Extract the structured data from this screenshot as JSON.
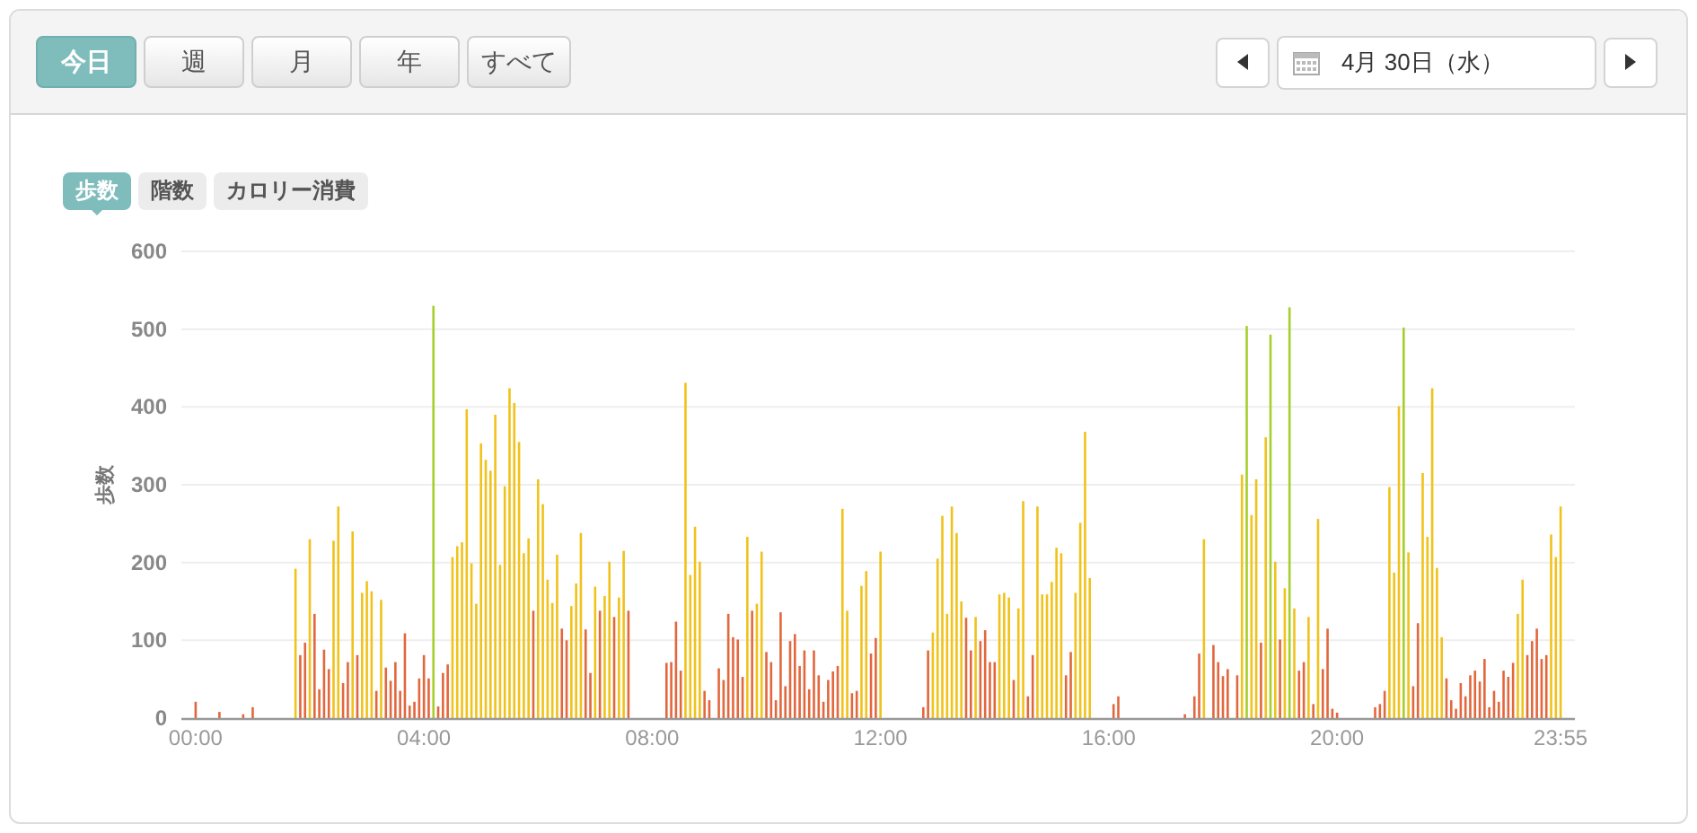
{
  "toolbar": {
    "periods": [
      {
        "label": "今日",
        "selected": true
      },
      {
        "label": "週",
        "selected": false
      },
      {
        "label": "月",
        "selected": false
      },
      {
        "label": "年",
        "selected": false
      },
      {
        "label": "すべて",
        "selected": false
      }
    ],
    "date": {
      "label": "4月 30日（水）"
    }
  },
  "metric_tabs": [
    {
      "label": "歩数",
      "selected": true
    },
    {
      "label": "階数",
      "selected": false
    },
    {
      "label": "カロリー消費",
      "selected": false
    }
  ],
  "chart": {
    "chart_data": {
      "type": "bar",
      "ylabel": "歩数",
      "ylim": [
        0,
        600
      ],
      "yticks": [
        0,
        100,
        200,
        300,
        400,
        500,
        600
      ],
      "grid": true,
      "x": [
        0,
        5,
        10,
        15,
        20,
        25,
        30,
        35,
        40,
        45,
        50,
        55,
        60,
        65,
        70,
        75,
        80,
        85,
        90,
        95,
        100,
        105,
        110,
        115,
        120,
        125,
        130,
        135,
        140,
        145,
        150,
        155,
        160,
        165,
        170,
        175,
        180,
        185,
        190,
        195,
        200,
        205,
        210,
        215,
        220,
        225,
        230,
        235,
        240,
        245,
        250,
        255,
        260,
        265,
        270,
        275,
        280,
        285,
        290,
        295,
        300,
        305,
        310,
        315,
        320,
        325,
        330,
        335,
        340,
        345,
        350,
        355,
        360,
        365,
        370,
        375,
        380,
        385,
        390,
        395,
        400,
        405,
        410,
        415,
        420,
        425,
        430,
        435,
        440,
        445,
        450,
        455,
        460,
        465,
        470,
        475,
        480,
        485,
        490,
        495,
        500,
        505,
        510,
        515,
        520,
        525,
        530,
        535,
        540,
        545,
        550,
        555,
        560,
        565,
        570,
        575,
        580,
        585,
        590,
        595,
        600,
        605,
        610,
        615,
        620,
        625,
        630,
        635,
        640,
        645,
        650,
        655,
        660,
        665,
        670,
        675,
        680,
        685,
        690,
        695,
        700,
        705,
        710,
        715,
        720,
        725,
        730,
        735,
        740,
        745,
        750,
        755,
        760,
        765,
        770,
        775,
        780,
        785,
        790,
        795,
        800,
        805,
        810,
        815,
        820,
        825,
        830,
        835,
        840,
        845,
        850,
        855,
        860,
        865,
        870,
        875,
        880,
        885,
        890,
        895,
        900,
        905,
        910,
        915,
        920,
        925,
        930,
        935,
        940,
        945,
        950,
        955,
        960,
        965,
        970,
        975,
        980,
        985,
        990,
        995,
        1000,
        1005,
        1010,
        1015,
        1020,
        1025,
        1030,
        1035,
        1040,
        1045,
        1050,
        1055,
        1060,
        1065,
        1070,
        1075,
        1080,
        1085,
        1090,
        1095,
        1100,
        1105,
        1110,
        1115,
        1120,
        1125,
        1130,
        1135,
        1140,
        1145,
        1150,
        1155,
        1160,
        1165,
        1170,
        1175,
        1180,
        1185,
        1190,
        1195,
        1200,
        1205,
        1210,
        1215,
        1220,
        1225,
        1230,
        1235,
        1240,
        1245,
        1250,
        1255,
        1260,
        1265,
        1270,
        1275,
        1280,
        1285,
        1290,
        1295,
        1300,
        1305,
        1310,
        1315,
        1320,
        1325,
        1330,
        1335,
        1340,
        1345,
        1350,
        1355,
        1360,
        1365,
        1370,
        1375,
        1380,
        1385,
        1390,
        1395,
        1400,
        1405,
        1410,
        1415,
        1420,
        1425,
        1430,
        1435
      ],
      "xlim": [
        -15,
        1450
      ],
      "xticks": [
        {
          "value": 0,
          "label": "00:00"
        },
        {
          "value": 240,
          "label": "04:00"
        },
        {
          "value": 480,
          "label": "08:00"
        },
        {
          "value": 720,
          "label": "12:00"
        },
        {
          "value": 960,
          "label": "16:00"
        },
        {
          "value": 1200,
          "label": "20:00"
        },
        {
          "value": 1435,
          "label": "23:55"
        }
      ],
      "series": [
        {
          "color": "#e2673d",
          "values": [
            21,
            null,
            null,
            null,
            null,
            8,
            null,
            null,
            null,
            null,
            5,
            null,
            14,
            null,
            null,
            null,
            null,
            null,
            null,
            null,
            null,
            null,
            81,
            97,
            null,
            134,
            37,
            88,
            63,
            null,
            null,
            45,
            72,
            null,
            81,
            null,
            null,
            null,
            35,
            null,
            65,
            48,
            72,
            35,
            109,
            16,
            21,
            51,
            81,
            51,
            null,
            15,
            58,
            69,
            null,
            null,
            null,
            null,
            null,
            null,
            null,
            null,
            null,
            null,
            null,
            null,
            null,
            null,
            null,
            null,
            null,
            138,
            null,
            null,
            null,
            null,
            null,
            115,
            100,
            null,
            null,
            null,
            114,
            58,
            null,
            138,
            null,
            null,
            130,
            null,
            null,
            138,
            null,
            null,
            null,
            null,
            null,
            null,
            null,
            71,
            72,
            124,
            61,
            null,
            null,
            null,
            null,
            35,
            23,
            null,
            64,
            49,
            134,
            104,
            101,
            53,
            null,
            138,
            null,
            null,
            85,
            72,
            23,
            136,
            41,
            99,
            108,
            67,
            87,
            37,
            87,
            55,
            21,
            49,
            60,
            67,
            null,
            null,
            32,
            35,
            null,
            null,
            83,
            103,
            null,
            null,
            null,
            null,
            null,
            null,
            null,
            null,
            null,
            14,
            87,
            null,
            null,
            null,
            null,
            null,
            null,
            null,
            129,
            87,
            null,
            99,
            113,
            72,
            72,
            null,
            null,
            null,
            49,
            null,
            null,
            28,
            81,
            null,
            null,
            null,
            null,
            null,
            null,
            55,
            85,
            null,
            null,
            null,
            null,
            null,
            null,
            null,
            null,
            18,
            28,
            null,
            null,
            null,
            null,
            null,
            null,
            null,
            null,
            null,
            null,
            null,
            null,
            null,
            5,
            null,
            28,
            83,
            null,
            null,
            94,
            72,
            54,
            63,
            null,
            55,
            null,
            null,
            null,
            null,
            97,
            null,
            null,
            null,
            101,
            null,
            null,
            null,
            61,
            72,
            null,
            18,
            null,
            63,
            115,
            12,
            7,
            null,
            null,
            null,
            null,
            null,
            null,
            null,
            14,
            18,
            35,
            null,
            null,
            null,
            null,
            null,
            41,
            122,
            null,
            null,
            null,
            null,
            null,
            51,
            23,
            12,
            45,
            28,
            55,
            61,
            47,
            76,
            14,
            35,
            21,
            61,
            53,
            71,
            null,
            null,
            81,
            99,
            115,
            76,
            81,
            null,
            null,
            null
          ]
        },
        {
          "color": "#f0c21a",
          "values": [
            null,
            null,
            null,
            null,
            null,
            null,
            null,
            null,
            null,
            null,
            null,
            null,
            null,
            null,
            null,
            null,
            null,
            null,
            null,
            null,
            null,
            192,
            null,
            null,
            230,
            null,
            null,
            null,
            null,
            228,
            272,
            null,
            null,
            240,
            null,
            161,
            176,
            163,
            null,
            152,
            null,
            null,
            null,
            null,
            null,
            null,
            null,
            null,
            null,
            null,
            null,
            null,
            null,
            null,
            207,
            221,
            226,
            397,
            199,
            147,
            353,
            332,
            318,
            390,
            197,
            298,
            424,
            405,
            355,
            212,
            231,
            null,
            307,
            275,
            178,
            148,
            210,
            null,
            null,
            144,
            173,
            238,
            null,
            null,
            169,
            null,
            157,
            201,
            null,
            155,
            215,
            null,
            null,
            null,
            null,
            null,
            null,
            null,
            null,
            null,
            null,
            null,
            null,
            431,
            184,
            246,
            201,
            null,
            null,
            null,
            null,
            null,
            null,
            null,
            null,
            null,
            233,
            null,
            147,
            214,
            null,
            null,
            null,
            null,
            null,
            null,
            null,
            null,
            null,
            null,
            null,
            null,
            null,
            null,
            null,
            null,
            269,
            138,
            null,
            null,
            170,
            189,
            null,
            null,
            214,
            null,
            null,
            null,
            null,
            null,
            null,
            null,
            null,
            null,
            null,
            110,
            205,
            260,
            134,
            272,
            238,
            150,
            null,
            null,
            130,
            null,
            null,
            null,
            null,
            159,
            161,
            155,
            null,
            141,
            279,
            null,
            null,
            272,
            159,
            159,
            175,
            219,
            212,
            null,
            null,
            161,
            251,
            368,
            180,
            null,
            null,
            null,
            null,
            null,
            null,
            null,
            null,
            null,
            null,
            null,
            null,
            null,
            null,
            null,
            null,
            null,
            null,
            null,
            null,
            null,
            null,
            null,
            230,
            null,
            null,
            null,
            null,
            null,
            null,
            null,
            313,
            null,
            261,
            307,
            null,
            361,
            null,
            201,
            null,
            167,
            null,
            141,
            null,
            null,
            130,
            null,
            256,
            null,
            null,
            null,
            null,
            null,
            null,
            null,
            null,
            null,
            null,
            null,
            null,
            null,
            null,
            297,
            187,
            401,
            null,
            213,
            null,
            null,
            315,
            233,
            424,
            193,
            104,
            null,
            null,
            null,
            null,
            null,
            null,
            null,
            null,
            null,
            null,
            null,
            null,
            null,
            null,
            null,
            134,
            178,
            null,
            null,
            null,
            null,
            null,
            236,
            207,
            272
          ]
        },
        {
          "color": "#a6cf2c",
          "values": [
            null,
            null,
            null,
            null,
            null,
            null,
            null,
            null,
            null,
            null,
            null,
            null,
            null,
            null,
            null,
            null,
            null,
            null,
            null,
            null,
            null,
            null,
            null,
            null,
            null,
            null,
            null,
            null,
            null,
            null,
            null,
            null,
            null,
            null,
            null,
            null,
            null,
            null,
            null,
            null,
            null,
            null,
            null,
            null,
            null,
            null,
            null,
            null,
            null,
            null,
            530,
            null,
            null,
            null,
            null,
            null,
            null,
            null,
            null,
            null,
            null,
            null,
            null,
            null,
            null,
            null,
            null,
            null,
            null,
            null,
            null,
            null,
            null,
            null,
            null,
            null,
            null,
            null,
            null,
            null,
            null,
            null,
            null,
            null,
            null,
            null,
            null,
            null,
            null,
            null,
            null,
            null,
            null,
            null,
            null,
            null,
            null,
            null,
            null,
            null,
            null,
            null,
            null,
            null,
            null,
            null,
            null,
            null,
            null,
            null,
            null,
            null,
            null,
            null,
            null,
            null,
            null,
            null,
            null,
            null,
            null,
            null,
            null,
            null,
            null,
            null,
            null,
            null,
            null,
            null,
            null,
            null,
            null,
            null,
            null,
            null,
            null,
            null,
            null,
            null,
            null,
            null,
            null,
            null,
            null,
            null,
            null,
            null,
            null,
            null,
            null,
            null,
            null,
            null,
            null,
            null,
            null,
            null,
            null,
            null,
            null,
            null,
            null,
            null,
            null,
            null,
            null,
            null,
            null,
            null,
            null,
            null,
            null,
            null,
            null,
            null,
            null,
            null,
            null,
            null,
            null,
            null,
            null,
            null,
            null,
            null,
            null,
            null,
            null,
            null,
            null,
            null,
            null,
            null,
            null,
            null,
            null,
            null,
            null,
            null,
            null,
            null,
            null,
            null,
            null,
            null,
            null,
            null,
            null,
            null,
            null,
            null,
            null,
            null,
            null,
            null,
            null,
            null,
            null,
            null,
            null,
            504,
            null,
            null,
            null,
            null,
            493,
            null,
            null,
            null,
            528,
            null,
            null,
            null,
            null,
            null,
            null,
            null,
            null,
            null,
            null,
            null,
            null,
            null,
            null,
            null,
            null,
            null,
            null,
            null,
            null,
            null,
            null,
            null,
            502,
            null,
            null,
            null,
            null,
            null,
            null,
            null,
            null,
            null,
            null,
            null,
            null,
            null,
            null,
            null,
            null,
            null,
            null,
            null,
            null,
            null,
            null,
            null,
            null,
            null,
            null,
            null,
            null,
            null,
            null,
            null,
            null,
            null
          ]
        }
      ]
    }
  }
}
